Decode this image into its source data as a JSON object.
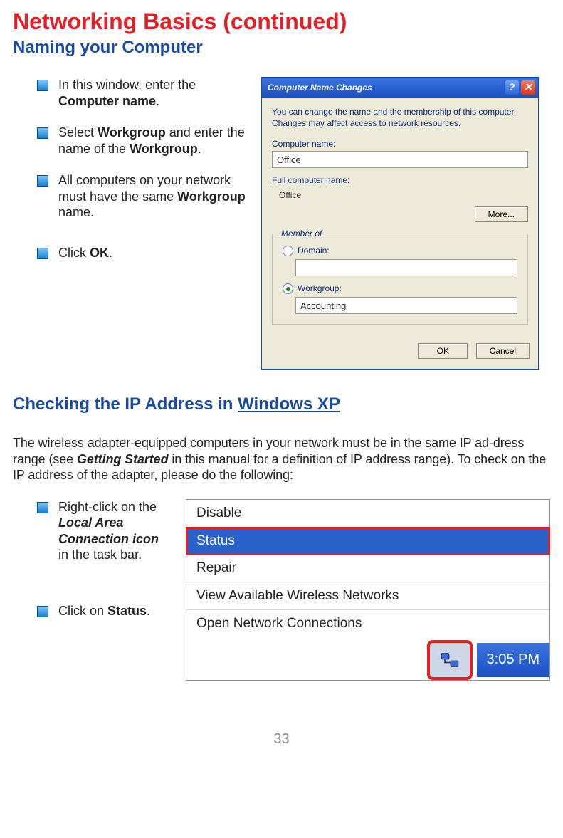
{
  "headings": {
    "main": "Networking Basics (continued)",
    "sub1": "Naming your Computer",
    "sub2_a": "Checking the IP Address in ",
    "sub2_b": "Windows XP"
  },
  "bullets": {
    "b1_a": "In this window, enter the ",
    "b1_b": "Computer  name",
    "b1_c": ".",
    "b2_a": "Select ",
    "b2_b": "Workgroup",
    "b2_c": " and enter the name of the ",
    "b2_d": "Workgroup",
    "b2_e": ".",
    "b3_a": "All computers on your network must have the same ",
    "b3_b": "Workgroup",
    "b3_c": " name.",
    "b4_a": "Click ",
    "b4_b": "OK",
    "b4_c": ".",
    "b5_a": "Right-click on the ",
    "b5_b": "Local Area Connection icon",
    "b5_c": " in the task bar.",
    "b6_a": "Click on ",
    "b6_b": "Status",
    "b6_c": "."
  },
  "para": {
    "p_a": "The wireless adapter-equipped computers in your network must be in the same IP ad‑dress range (see ",
    "p_b": "Getting Started",
    "p_c": " in this manual for a definition of IP address range). To check on the IP address of the adapter, please do the following:"
  },
  "dialog": {
    "title": "Computer Name Changes",
    "desc": "You can change the name and the membership of this computer. Changes may affect access to network resources.",
    "label_comp": "Computer name:",
    "value_comp": "Office",
    "label_full": "Full computer name:",
    "value_full": "Office",
    "btn_more": "More...",
    "group_title": "Member of",
    "radio_domain": "Domain:",
    "value_domain": "",
    "radio_workgroup": "Workgroup:",
    "value_workgroup": "Accounting",
    "btn_ok": "OK",
    "btn_cancel": "Cancel"
  },
  "context_menu": {
    "items": [
      "Disable",
      "Status",
      "Repair",
      "View Available Wireless Networks",
      "Open Network Connections"
    ],
    "clock": "3:05 PM"
  },
  "page_number": "33"
}
